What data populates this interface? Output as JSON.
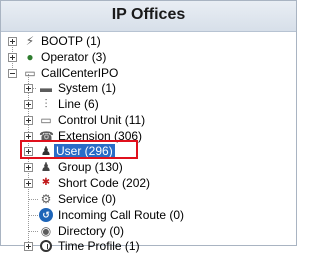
{
  "panel": {
    "title": "IP Offices"
  },
  "tree": {
    "bootp": "BOOTP (1)",
    "operator": "Operator (3)",
    "root": "CallCenterIPO",
    "system": "System (1)",
    "line": "Line (6)",
    "control_unit": "Control Unit (11)",
    "extension": "Extension (306)",
    "user": "User (296)",
    "group": "Group (130)",
    "short_code": "Short Code (202)",
    "service": "Service (0)",
    "incoming_call_route": "Incoming Call Route (0)",
    "directory": "Directory (0)",
    "time_profile": "Time Profile (1)"
  },
  "colors": {
    "selection": "#2a6cc7",
    "highlight_border": "#e0101c",
    "header_bg": "#dde4ec"
  }
}
